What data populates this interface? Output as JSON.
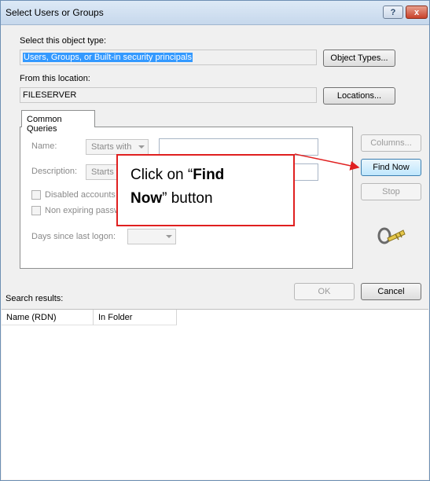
{
  "window": {
    "title": "Select Users or Groups",
    "help_label": "?",
    "close_label": "x"
  },
  "object_type": {
    "label": "Select this object type:",
    "value": "Users, Groups, or Built-in security principals",
    "button": "Object Types..."
  },
  "location": {
    "label": "From this location:",
    "value": "FILESERVER",
    "button": "Locations..."
  },
  "tabs": [
    {
      "label": "Common Queries"
    }
  ],
  "queries": {
    "name_label": "Name:",
    "name_mode": "Starts with",
    "description_label": "Description:",
    "description_mode": "Starts with",
    "disabled_label": "Disabled accounts",
    "non_expiring_label": "Non expiring password",
    "days_label": "Days since last logon:"
  },
  "side_buttons": {
    "columns": "Columns...",
    "find_now": "Find Now",
    "stop": "Stop"
  },
  "footer": {
    "ok": "OK",
    "cancel": "Cancel",
    "results_label": "Search results:"
  },
  "results_columns": [
    "Name (RDN)",
    "In Folder"
  ],
  "callout": {
    "prefix": "Click on “",
    "bold": "Find Now",
    "suffix": "” button"
  },
  "colors": {
    "callout_red": "#e02020",
    "selection_blue": "#3399ff"
  }
}
